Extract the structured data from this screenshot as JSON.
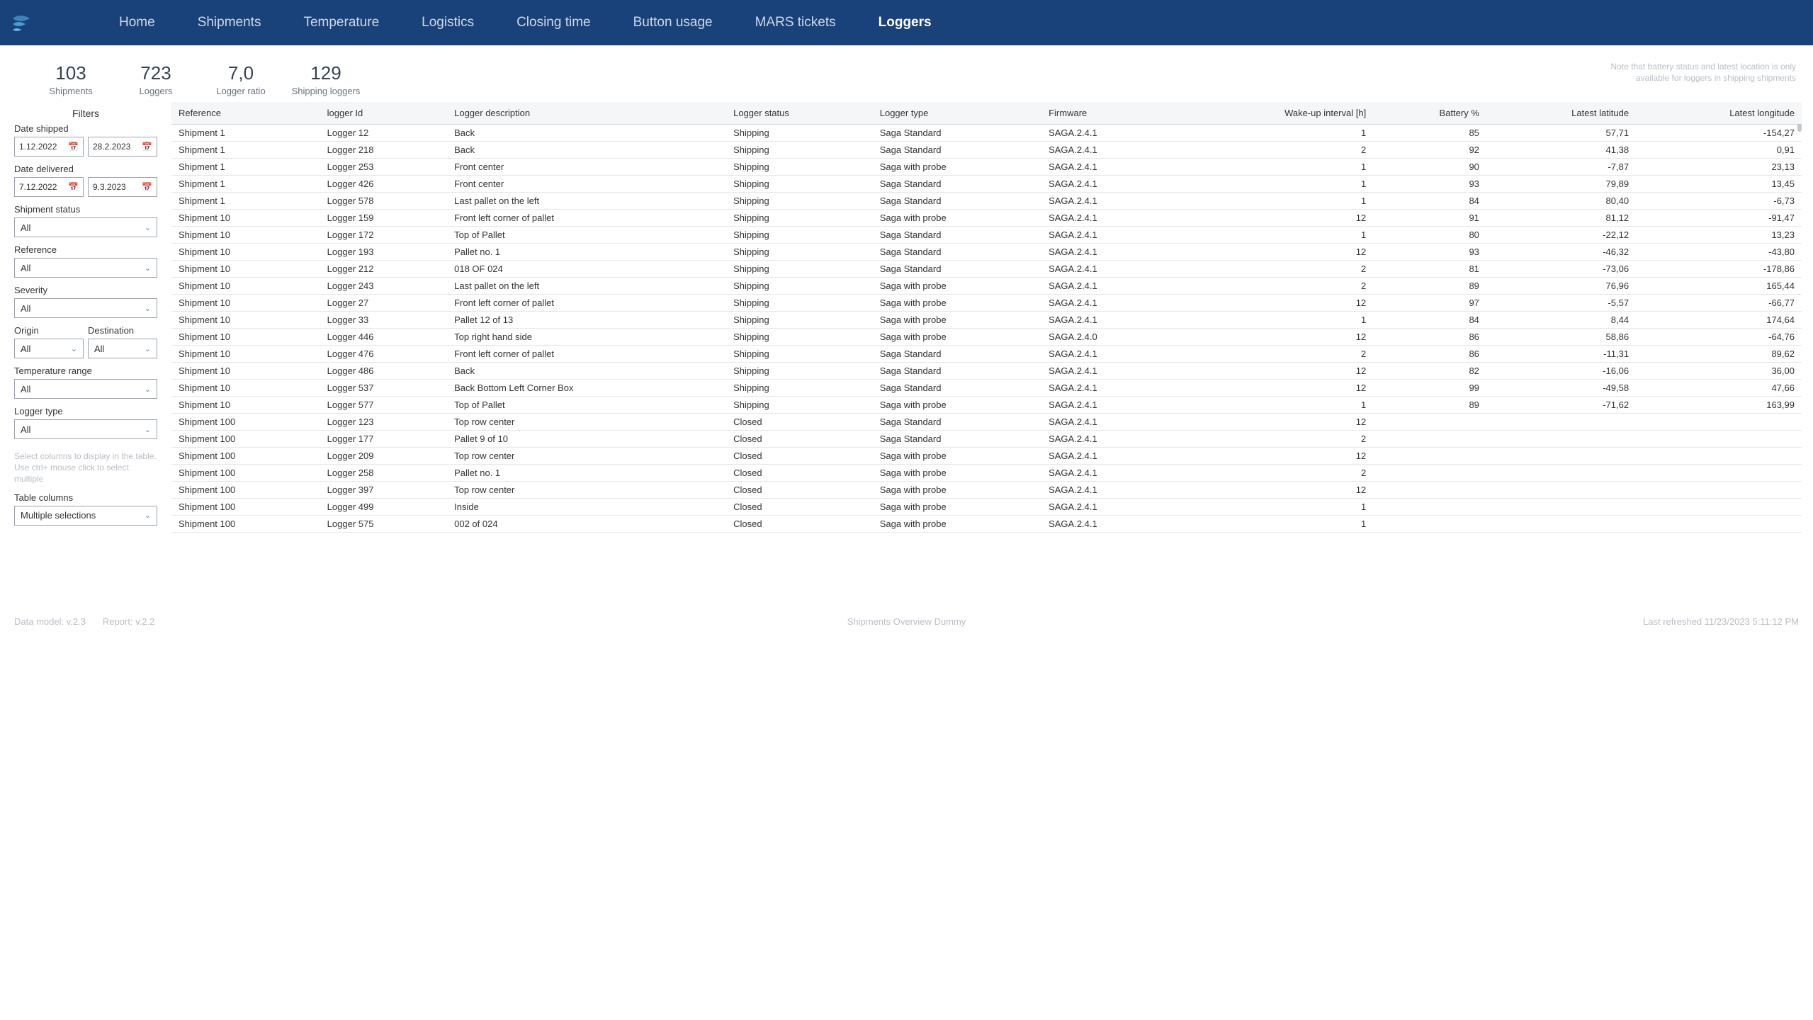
{
  "nav": {
    "items": [
      "Home",
      "Shipments",
      "Temperature",
      "Logistics",
      "Closing time",
      "Button usage",
      "MARS tickets",
      "Loggers"
    ],
    "active": "Loggers"
  },
  "metrics": [
    {
      "value": "103",
      "label": "Shipments"
    },
    {
      "value": "723",
      "label": "Loggers"
    },
    {
      "value": "7,0",
      "label": "Logger ratio"
    },
    {
      "value": "129",
      "label": "Shipping loggers"
    }
  ],
  "note": "Note that battery status and latest location is only available for loggers in shipping shipments",
  "filters": {
    "title": "Filters",
    "date_shipped": {
      "label": "Date shipped",
      "from": "1.12.2022",
      "to": "28.2.2023"
    },
    "date_delivered": {
      "label": "Date delivered",
      "from": "7.12.2022",
      "to": "9.3.2023"
    },
    "shipment_status": {
      "label": "Shipment status",
      "value": "All"
    },
    "reference": {
      "label": "Reference",
      "value": "All"
    },
    "severity": {
      "label": "Severity",
      "value": "All"
    },
    "origin": {
      "label": "Origin",
      "value": "All"
    },
    "destination": {
      "label": "Destination",
      "value": "All"
    },
    "temp_range": {
      "label": "Temperature range",
      "value": "All"
    },
    "logger_type": {
      "label": "Logger type",
      "value": "All"
    },
    "helper": "Select columns to display in the table. Use ctrl+ mouse click to select multiple",
    "table_cols": {
      "label": "Table columns",
      "value": "Multiple selections"
    }
  },
  "table": {
    "headers": [
      "Reference",
      "logger Id",
      "Logger description",
      "Logger status",
      "Logger type",
      "Firmware",
      "Wake-up interval [h]",
      "Battery %",
      "Latest latitude",
      "Latest longitude"
    ],
    "rows": [
      [
        "Shipment 1",
        "Logger 12",
        "Back",
        "Shipping",
        "Saga Standard",
        "SAGA.2.4.1",
        "1",
        "85",
        "57,71",
        "-154,27"
      ],
      [
        "Shipment 1",
        "Logger 218",
        "Back",
        "Shipping",
        "Saga Standard",
        "SAGA.2.4.1",
        "2",
        "92",
        "41,38",
        "0,91"
      ],
      [
        "Shipment 1",
        "Logger 253",
        "Front center",
        "Shipping",
        "Saga with probe",
        "SAGA.2.4.1",
        "1",
        "90",
        "-7,87",
        "23,13"
      ],
      [
        "Shipment 1",
        "Logger 426",
        "Front center",
        "Shipping",
        "Saga Standard",
        "SAGA.2.4.1",
        "1",
        "93",
        "79,89",
        "13,45"
      ],
      [
        "Shipment 1",
        "Logger 578",
        "Last pallet on the left",
        "Shipping",
        "Saga Standard",
        "SAGA.2.4.1",
        "1",
        "84",
        "80,40",
        "-6,73"
      ],
      [
        "Shipment 10",
        "Logger 159",
        "Front left corner of pallet",
        "Shipping",
        "Saga with probe",
        "SAGA.2.4.1",
        "12",
        "91",
        "81,12",
        "-91,47"
      ],
      [
        "Shipment 10",
        "Logger 172",
        "Top of Pallet",
        "Shipping",
        "Saga Standard",
        "SAGA.2.4.1",
        "1",
        "80",
        "-22,12",
        "13,23"
      ],
      [
        "Shipment 10",
        "Logger 193",
        "Pallet no. 1",
        "Shipping",
        "Saga Standard",
        "SAGA.2.4.1",
        "12",
        "93",
        "-46,32",
        "-43,80"
      ],
      [
        "Shipment 10",
        "Logger 212",
        "018 OF 024",
        "Shipping",
        "Saga Standard",
        "SAGA.2.4.1",
        "2",
        "81",
        "-73,06",
        "-178,86"
      ],
      [
        "Shipment 10",
        "Logger 243",
        "Last pallet on the left",
        "Shipping",
        "Saga with probe",
        "SAGA.2.4.1",
        "2",
        "89",
        "76,96",
        "165,44"
      ],
      [
        "Shipment 10",
        "Logger 27",
        "Front left corner of pallet",
        "Shipping",
        "Saga with probe",
        "SAGA.2.4.1",
        "12",
        "97",
        "-5,57",
        "-66,77"
      ],
      [
        "Shipment 10",
        "Logger 33",
        "Pallet 12 of 13",
        "Shipping",
        "Saga with probe",
        "SAGA.2.4.1",
        "1",
        "84",
        "8,44",
        "174,64"
      ],
      [
        "Shipment 10",
        "Logger 446",
        "Top right hand side",
        "Shipping",
        "Saga with probe",
        "SAGA.2.4.0",
        "12",
        "86",
        "58,86",
        "-64,76"
      ],
      [
        "Shipment 10",
        "Logger 476",
        "Front left corner of pallet",
        "Shipping",
        "Saga Standard",
        "SAGA.2.4.1",
        "2",
        "86",
        "-11,31",
        "89,62"
      ],
      [
        "Shipment 10",
        "Logger 486",
        "Back",
        "Shipping",
        "Saga Standard",
        "SAGA.2.4.1",
        "12",
        "82",
        "-16,06",
        "36,00"
      ],
      [
        "Shipment 10",
        "Logger 537",
        "Back Bottom Left Corner Box",
        "Shipping",
        "Saga Standard",
        "SAGA.2.4.1",
        "12",
        "99",
        "-49,58",
        "47,66"
      ],
      [
        "Shipment 10",
        "Logger 577",
        "Top of Pallet",
        "Shipping",
        "Saga with probe",
        "SAGA.2.4.1",
        "1",
        "89",
        "-71,62",
        "163,99"
      ],
      [
        "Shipment 100",
        "Logger 123",
        "Top row center",
        "Closed",
        "Saga Standard",
        "SAGA.2.4.1",
        "12",
        "",
        "",
        ""
      ],
      [
        "Shipment 100",
        "Logger 177",
        "Pallet 9 of 10",
        "Closed",
        "Saga Standard",
        "SAGA.2.4.1",
        "2",
        "",
        "",
        ""
      ],
      [
        "Shipment 100",
        "Logger 209",
        "Top row center",
        "Closed",
        "Saga with probe",
        "SAGA.2.4.1",
        "12",
        "",
        "",
        ""
      ],
      [
        "Shipment 100",
        "Logger 258",
        "Pallet no. 1",
        "Closed",
        "Saga with probe",
        "SAGA.2.4.1",
        "2",
        "",
        "",
        ""
      ],
      [
        "Shipment 100",
        "Logger 397",
        "Top row center",
        "Closed",
        "Saga with probe",
        "SAGA.2.4.1",
        "12",
        "",
        "",
        ""
      ],
      [
        "Shipment 100",
        "Logger 499",
        "Inside",
        "Closed",
        "Saga with probe",
        "SAGA.2.4.1",
        "1",
        "",
        "",
        ""
      ],
      [
        "Shipment 100",
        "Logger 575",
        "002 of 024",
        "Closed",
        "Saga with probe",
        "SAGA.2.4.1",
        "1",
        "",
        "",
        ""
      ]
    ]
  },
  "footer": {
    "data_model": "Data model: v.2.3",
    "report": "Report: v.2.2",
    "center": "Shipments Overview Dummy",
    "refreshed": "Last refreshed 11/23/2023 5:11:12 PM"
  }
}
